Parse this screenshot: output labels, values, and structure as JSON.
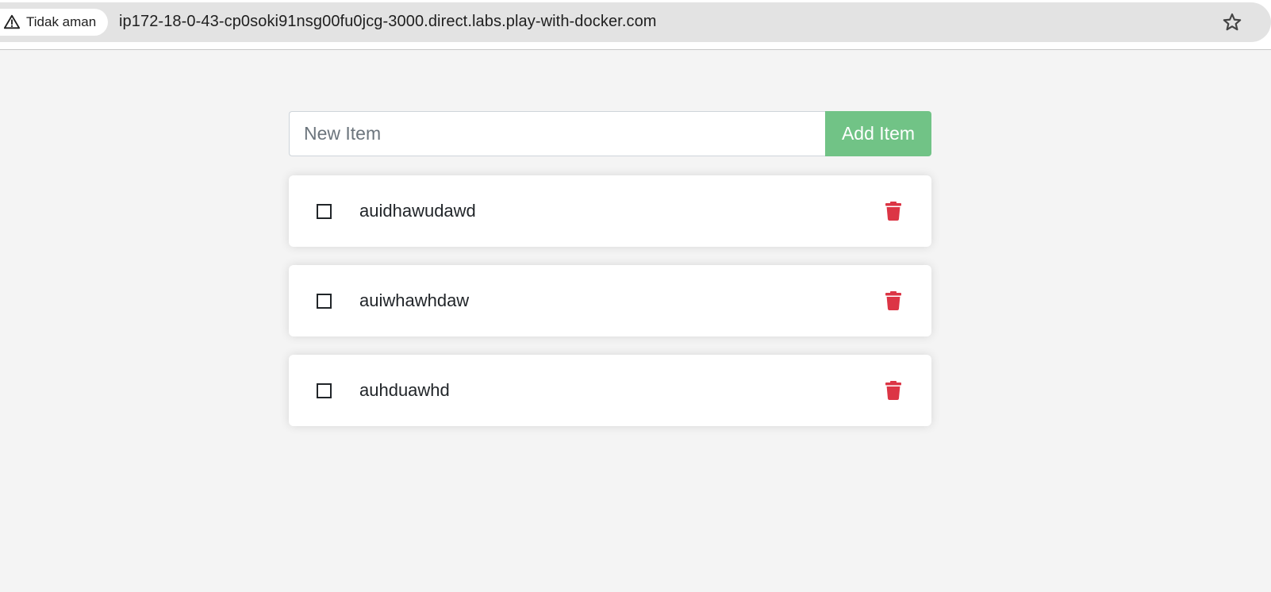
{
  "browser": {
    "security_label": "Tidak aman",
    "url": "ip172-18-0-43-cp0soki91nsg00fu0jcg-3000.direct.labs.play-with-docker.com",
    "icons": {
      "security": "warning-triangle-icon",
      "bookmark": "star-icon"
    }
  },
  "form": {
    "input_placeholder": "New Item",
    "input_value": "",
    "add_label": "Add Item",
    "add_color": "#71c386"
  },
  "items": [
    {
      "name": "auidhawudawd",
      "completed": false
    },
    {
      "name": "auiwhawhdaw",
      "completed": false
    },
    {
      "name": "auhduawhd",
      "completed": false
    }
  ],
  "colors": {
    "remove_icon": "#dc3545",
    "background": "#f4f4f4"
  },
  "icons": {
    "toggle": "checkbox-icon",
    "remove": "trash-icon"
  }
}
